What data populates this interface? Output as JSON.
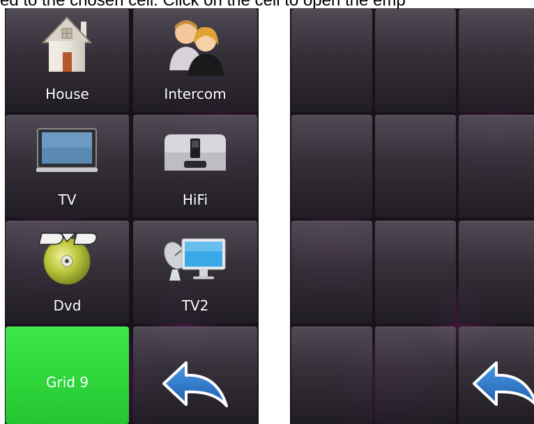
{
  "caption": "ed to the chosen cell. Click on the cell to open the emp",
  "left_panel": {
    "tiles": [
      {
        "label": "House",
        "icon": "house-icon"
      },
      {
        "label": "Intercom",
        "icon": "intercom-people-icon"
      },
      {
        "label": "TV",
        "icon": "tv-icon"
      },
      {
        "label": "HiFi",
        "icon": "hifi-speaker-icon"
      },
      {
        "label": "Dvd",
        "icon": "dvd-disc-icon"
      },
      {
        "label": "TV2",
        "icon": "tv-satellite-icon"
      },
      {
        "label": "Grid 9",
        "icon": ""
      },
      {
        "label": "",
        "icon": "back-arrow-icon"
      }
    ]
  },
  "right_panel": {
    "empty_cells": 11,
    "back_icon": "back-arrow-icon"
  },
  "colors": {
    "background": "#171219",
    "tile": "#3a343e",
    "accent_green": "#2fd63b",
    "back_arrow": "#1f6fc4",
    "glow": "#a828b4"
  }
}
